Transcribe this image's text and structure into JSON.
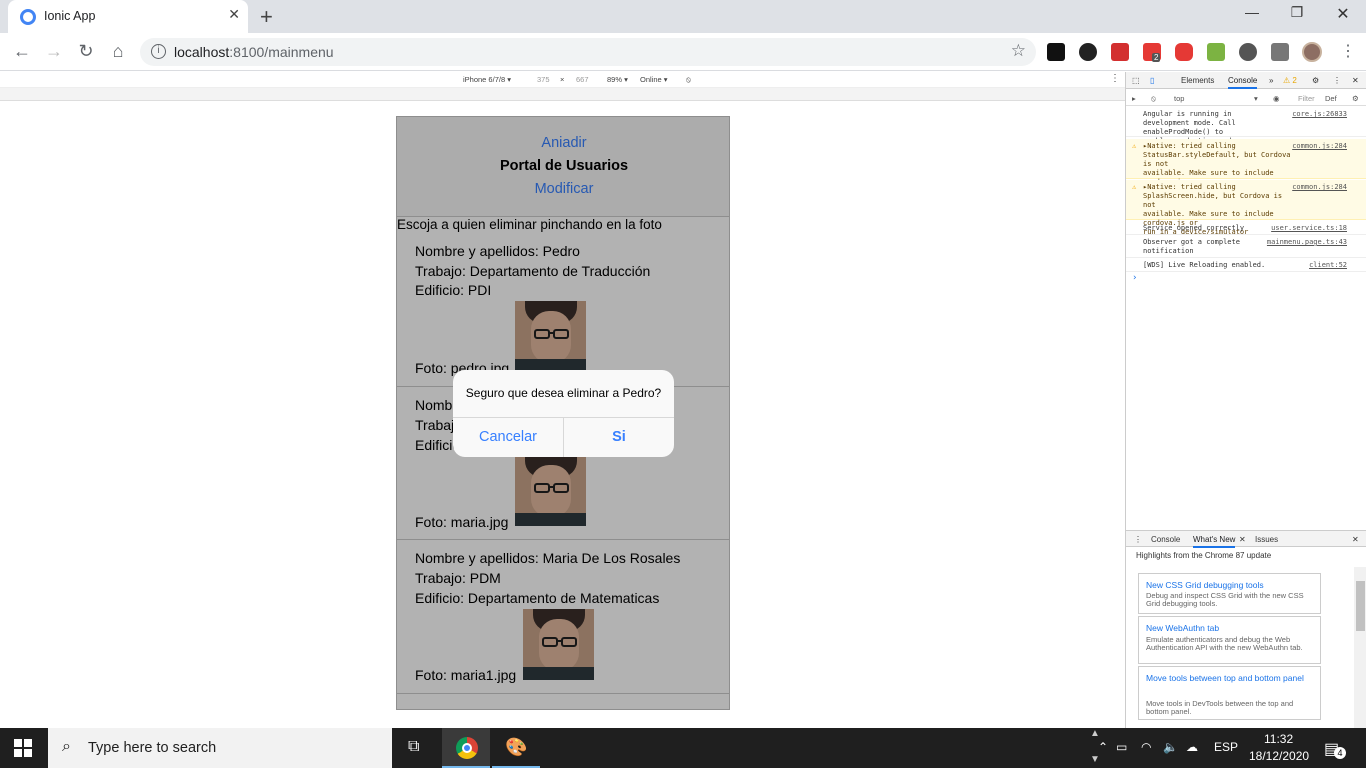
{
  "browser": {
    "tab_title": "Ionic App",
    "url_host": "localhost",
    "url_rest": ":8100/mainmenu",
    "ext_badge": "2"
  },
  "device_toolbar": {
    "device": "iPhone 6/7/8 ▾",
    "width": "375",
    "x": "×",
    "height": "667",
    "zoom": "89% ▾",
    "network": "Online ▾"
  },
  "app": {
    "add_label": "Aniadir",
    "title": "Portal de Usuarios",
    "modify_label": "Modificar",
    "instructions": "Escoja a quien eliminar pinchando en la foto",
    "users": [
      {
        "name": "Nombre y apellidos: Pedro",
        "job": "Trabajo: Departamento de Traducción",
        "building": "Edificio: PDI",
        "photo": "Foto: pedro.jpg"
      },
      {
        "name": "Nombre y apellidos: Maria",
        "job": "Trabajo: PDM",
        "building": "Edificio: PDM",
        "photo": "Foto: maria.jpg"
      },
      {
        "name": "Nombre y apellidos: Maria De Los Rosales",
        "job": "Trabajo: PDM",
        "building": "Edificio: Departamento de Matematicas",
        "photo": "Foto: maria1.jpg"
      }
    ]
  },
  "alert": {
    "message": "Seguro que desea eliminar a Pedro?",
    "cancel": "Cancelar",
    "confirm": "Si"
  },
  "devtools": {
    "tab_elements": "Elements",
    "tab_console": "Console",
    "more_tabs": "»",
    "warn_count": "⚠ 2",
    "context": "top",
    "filter_placeholder": "Filter",
    "levels": "Def",
    "messages": [
      {
        "text": "Angular is running in\ndevelopment mode. Call enableProdMode() to\nenable production mode.",
        "source": "core.js:26833",
        "level": "info"
      },
      {
        "text": "▸Native: tried calling\nStatusBar.styleDefault, but Cordova is not\navailable. Make sure to include cordova.js or\nrun in a device/simulator",
        "source": "common.js:284",
        "level": "warn"
      },
      {
        "text": "▸Native: tried calling\nSplashScreen.hide, but Cordova is not\navailable. Make sure to include cordova.js or\nrun in a device/simulator",
        "source": "common.js:284",
        "level": "warn"
      },
      {
        "text": "Service opened correctly",
        "source": "user.service.ts:18",
        "level": "info"
      },
      {
        "text": "Observer got a complete\nnotification",
        "source": "mainmenu.page.ts:43",
        "level": "info"
      },
      {
        "text": "[WDS] Live Reloading enabled.",
        "source": "client:52",
        "level": "info"
      }
    ],
    "prompt": "›",
    "drawer_tabs": [
      "Console",
      "What's New",
      "Issues"
    ],
    "whats_new_heading": "Highlights from the Chrome 87 update",
    "whats_new": [
      {
        "title": "New CSS Grid debugging tools",
        "desc": "Debug and inspect CSS Grid with the new CSS Grid debugging tools."
      },
      {
        "title": "New WebAuthn tab",
        "desc": "Emulate authenticators and debug the Web Authentication API with the new WebAuthn tab."
      },
      {
        "title": "Move tools between top and bottom panel",
        "desc": "Move tools in DevTools between the top and bottom panel."
      }
    ]
  },
  "taskbar": {
    "search_placeholder": "Type here to search",
    "language": "ESP",
    "time": "11:32",
    "date": "18/12/2020",
    "notif_count": "4"
  }
}
